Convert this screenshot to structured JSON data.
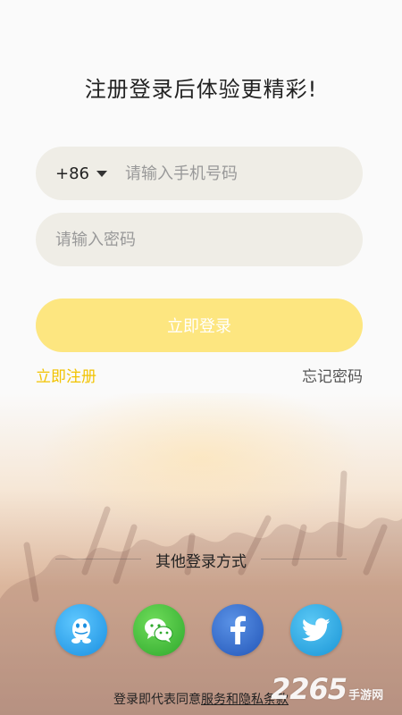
{
  "header": {
    "title": "注册登录后体验更精彩!"
  },
  "phone": {
    "country_code": "+86",
    "placeholder": "请输入手机号码"
  },
  "password": {
    "placeholder": "请输入密码"
  },
  "actions": {
    "login_label": "立即登录",
    "register_label": "立即注册",
    "forgot_label": "忘记密码"
  },
  "other_login": {
    "title": "其他登录方式",
    "providers": [
      "qq-icon",
      "wechat-icon",
      "facebook-icon",
      "twitter-icon"
    ]
  },
  "agreement": {
    "prefix": "登录即代表同意",
    "link": "服务和隐私条款"
  },
  "watermark": {
    "number": "2265",
    "suffix": "手游网"
  },
  "colors": {
    "accent_yellow": "#fde680",
    "register_link": "#f2c300",
    "qq_blue": "#1a8fe0",
    "wechat_green": "#2ea82c",
    "facebook_blue": "#2356b8",
    "twitter_blue": "#1a95d6"
  }
}
